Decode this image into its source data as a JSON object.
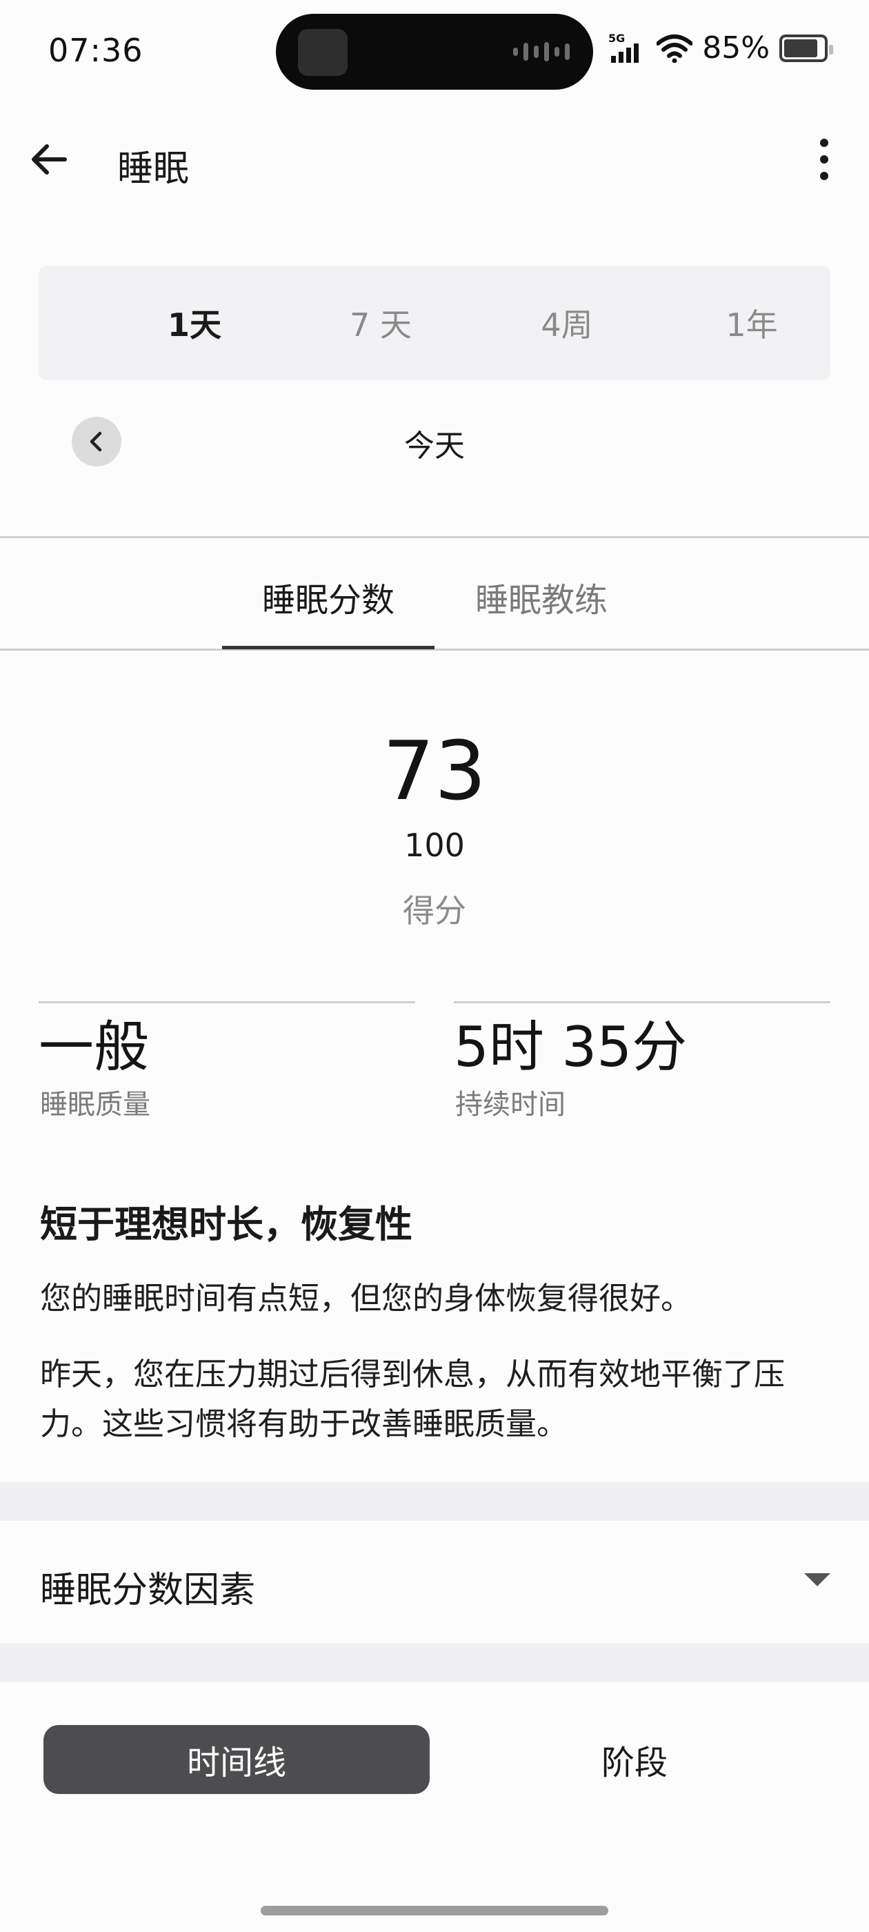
{
  "status_bar": {
    "time": "07:36",
    "network": "5G",
    "battery_percent": "85%",
    "battery_level": 0.85
  },
  "header": {
    "title": "睡眠"
  },
  "range_tabs": [
    {
      "label": "1天",
      "active": true
    },
    {
      "label": "7 天",
      "active": false
    },
    {
      "label": "4周",
      "active": false
    },
    {
      "label": "1年",
      "active": false
    }
  ],
  "date_nav": {
    "label": "今天"
  },
  "section_tabs": [
    {
      "label": "睡眠分数",
      "active": true
    },
    {
      "label": "睡眠教练",
      "active": false
    }
  ],
  "score": {
    "value": "73",
    "max": "100",
    "label": "得分"
  },
  "metrics": [
    {
      "value": "一般",
      "label": "睡眠质量"
    },
    {
      "value": "5时 35分",
      "label": "持续时间"
    }
  ],
  "summary": {
    "title": "短于理想时长，恢复性",
    "paragraphs": [
      "您的睡眠时间有点短，但您的身体恢复得很好。",
      "昨天，您在压力期过后得到休息，从而有效地平衡了压力。这些习惯将有助于改善睡眠质量。"
    ]
  },
  "factors": {
    "label": "睡眠分数因素"
  },
  "view_toggle": {
    "timeline_label": "时间线",
    "stages_label": "阶段",
    "active": "时间线"
  },
  "colors": {
    "active_button_bg": "#4d4c4f",
    "segment_bg": "#f2f1f3",
    "band_bg": "#f0eff1",
    "page_bg": "#fdfcfd"
  }
}
